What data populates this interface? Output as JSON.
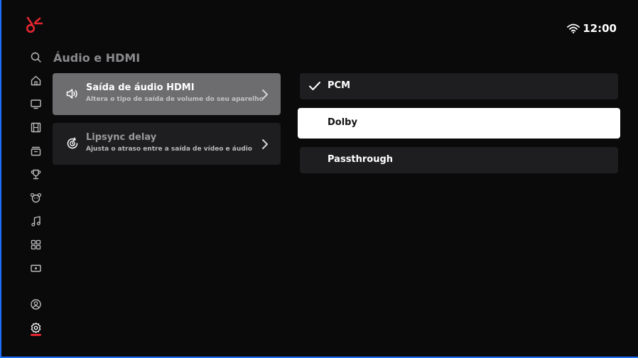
{
  "header": {
    "logo_icon": "brand-logo-icon",
    "wifi_icon": "wifi-icon",
    "clock": "12:00"
  },
  "sidebar": {
    "items": [
      {
        "icon": "search-icon"
      },
      {
        "icon": "home-icon"
      },
      {
        "icon": "tv-icon"
      },
      {
        "icon": "film-icon"
      },
      {
        "icon": "store-icon"
      },
      {
        "icon": "trophy-icon"
      },
      {
        "icon": "kids-icon"
      },
      {
        "icon": "music-icon"
      },
      {
        "icon": "apps-grid-icon"
      },
      {
        "icon": "ticket-icon"
      },
      {
        "icon": "profile-icon"
      },
      {
        "icon": "settings-gear-icon",
        "active": true
      }
    ],
    "active_color": "#e3262f"
  },
  "page": {
    "title": "Áudio e HDMI"
  },
  "menu": [
    {
      "title": "Saída de áudio HDMI",
      "subtitle": "Altera o tipo de saída de volume do seu aparelho",
      "icon": "speaker-icon",
      "selected": true
    },
    {
      "title": "Lipsync delay",
      "subtitle": "Ajusta o atraso entre a saída de vídeo e áudio",
      "icon": "sync-clock-icon",
      "selected": false
    }
  ],
  "options": [
    {
      "label": "PCM",
      "checked": true
    },
    {
      "label": "Dolby",
      "focused": true
    },
    {
      "label": "Passthrough"
    }
  ],
  "colors": {
    "background": "#0a0a0b",
    "accent": "#e3262f",
    "frame": "#1f6fff"
  }
}
